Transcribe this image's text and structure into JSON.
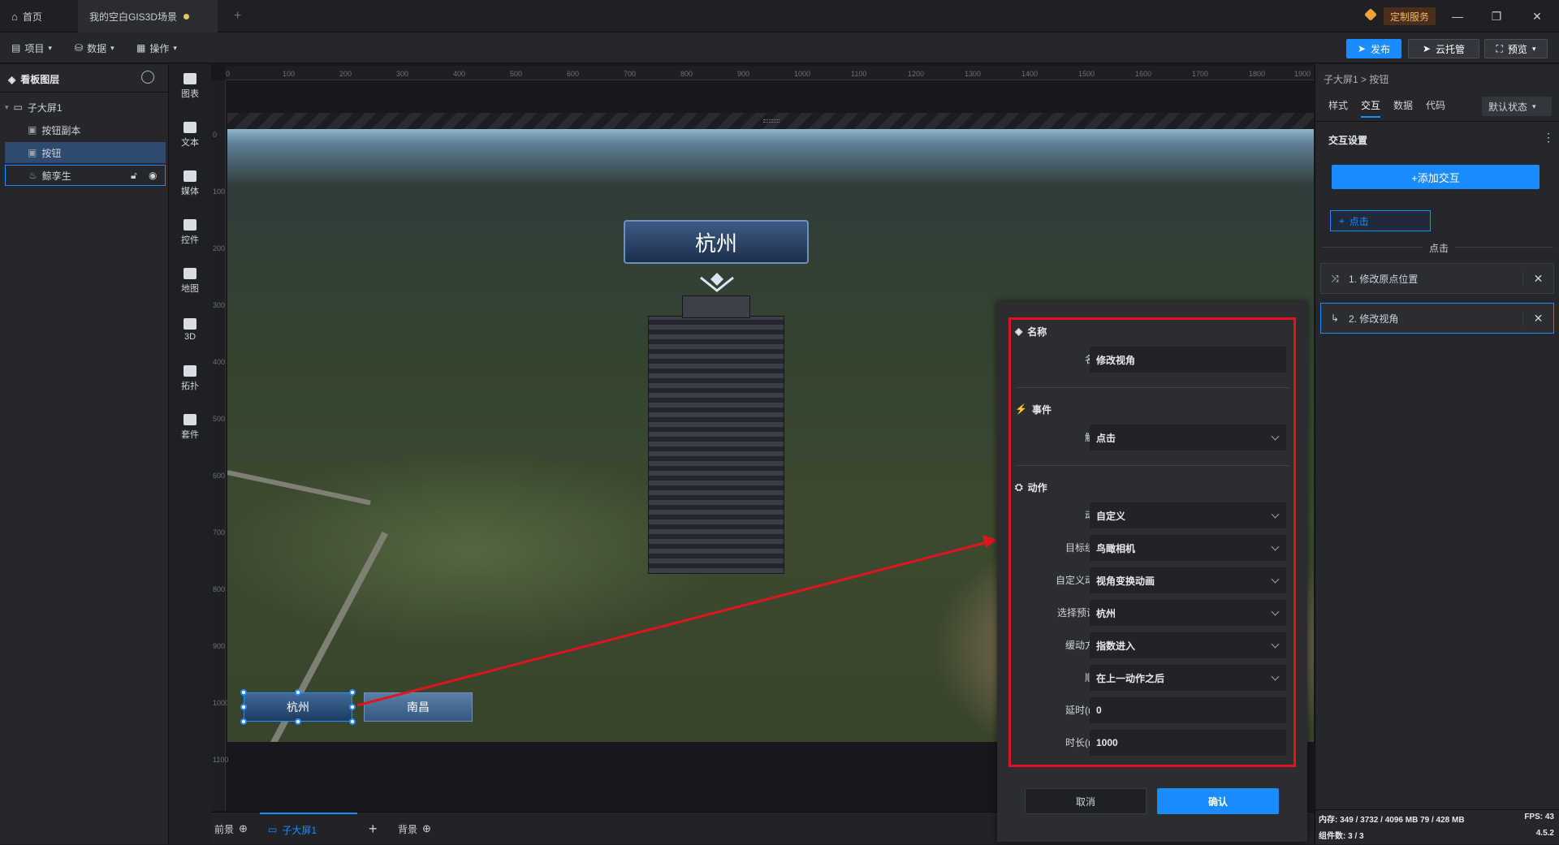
{
  "titlebar": {
    "home_tab": "首页",
    "scene_tab": "我的空白GIS3D场景",
    "add_tab": "+",
    "custom_service": "定制服务"
  },
  "toolbar": {
    "menu_project": "项目",
    "menu_data": "数据",
    "menu_operate": "操作",
    "publish": "发布",
    "cloud_host": "云托管",
    "preview": "预览"
  },
  "layers": {
    "title": "看板图层",
    "items": [
      {
        "label": "子大屏1"
      },
      {
        "label": "按钮副本"
      },
      {
        "label": "按钮"
      },
      {
        "label": "鲸孪生"
      }
    ]
  },
  "tools": [
    {
      "label": "图表",
      "icon": "chart-icon"
    },
    {
      "label": "文本",
      "icon": "text-icon"
    },
    {
      "label": "媒体",
      "icon": "media-icon"
    },
    {
      "label": "控件",
      "icon": "control-icon"
    },
    {
      "label": "地图",
      "icon": "map-icon"
    },
    {
      "label": "3D",
      "icon": "cube-icon"
    },
    {
      "label": "拓扑",
      "icon": "topology-icon"
    },
    {
      "label": "套件",
      "icon": "kit-icon"
    }
  ],
  "ruler": {
    "top": [
      "0",
      "100",
      "200",
      "300",
      "400",
      "500",
      "600",
      "700",
      "800",
      "900",
      "1000",
      "1100",
      "1200",
      "1300",
      "1400",
      "1500",
      "1600",
      "1700",
      "1800",
      "1900"
    ],
    "left": [
      "0",
      "100",
      "200",
      "300",
      "400",
      "500",
      "600",
      "700",
      "800",
      "900",
      "1000",
      "1100"
    ]
  },
  "scene": {
    "city_label": "杭州",
    "button_a": "杭州",
    "button_b": "南昌"
  },
  "bottombar": {
    "foreground": "前景",
    "screen": "子大屏1",
    "add": "+",
    "background": "背景"
  },
  "rightpanel": {
    "breadcrumb": "子大屏1 > 按钮",
    "tabs": [
      "样式",
      "交互",
      "数据",
      "代码"
    ],
    "state_select": "默认状态",
    "section_title": "交互设置",
    "add_interaction": "+添加交互",
    "event_tag": "点击",
    "event_header": "点击",
    "interactions": [
      "1. 修改原点位置",
      "2. 修改视角"
    ]
  },
  "dialog": {
    "section_name": "名称",
    "name_label": "名称",
    "name_value": "修改视角",
    "section_event": "事件",
    "trigger_label": "触发",
    "trigger_value": "点击",
    "section_action": "动作",
    "fields": [
      {
        "label": "动作",
        "value": "自定义",
        "dropdown": true
      },
      {
        "label": "目标组件",
        "value": "鸟瞰相机",
        "dropdown": true
      },
      {
        "label": "自定义动作",
        "value": "视角变换动画",
        "dropdown": true
      },
      {
        "label": "选择预设...",
        "value": "杭州",
        "dropdown": true
      },
      {
        "label": "缓动方式",
        "value": "指数进入",
        "dropdown": true
      },
      {
        "label": "顺序",
        "value": "在上一动作之后",
        "dropdown": true
      },
      {
        "label": "延时(ms)",
        "value": "0",
        "dropdown": false
      },
      {
        "label": "时长(ms)",
        "value": "1000",
        "dropdown": false
      }
    ],
    "cancel": "取消",
    "confirm": "确认"
  },
  "status": {
    "memory": "内存:  349 / 3732 / 4096 MB  79 / 428 MB",
    "fps": "FPS:  43",
    "components": "组件数: 3 / 3",
    "version": "4.5.2"
  },
  "colors": {
    "accent": "#1a8cff",
    "highlight_red": "#e0141e",
    "panel": "#25272b"
  }
}
